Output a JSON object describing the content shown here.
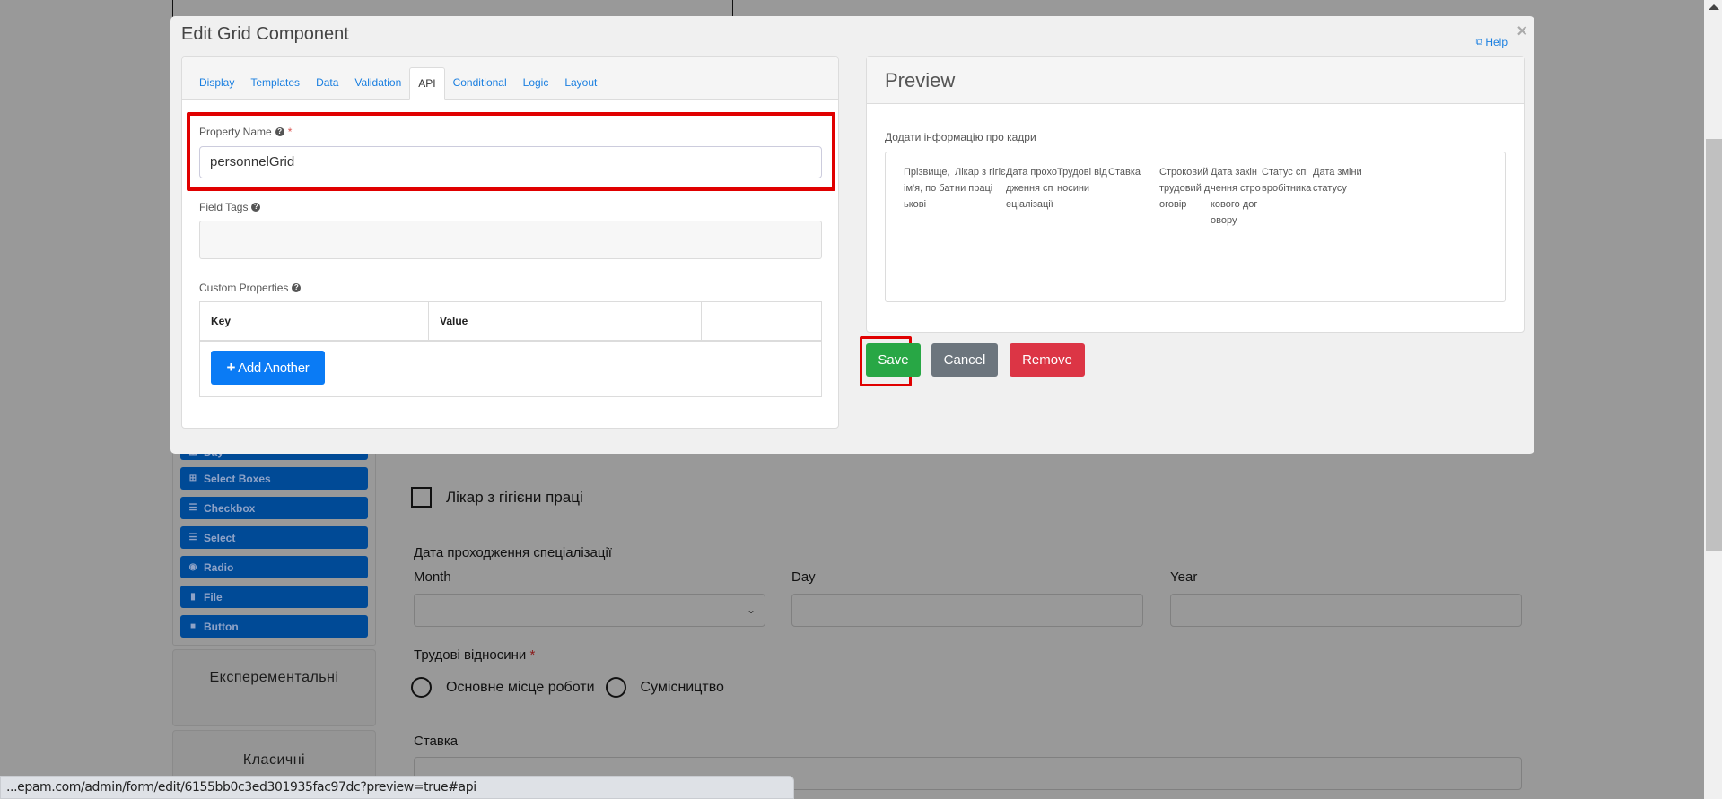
{
  "modal": {
    "title": "Edit Grid Component",
    "help_label": "Help",
    "close_label": "×",
    "tabs": [
      {
        "label": "Display"
      },
      {
        "label": "Templates"
      },
      {
        "label": "Data"
      },
      {
        "label": "Validation"
      },
      {
        "label": "API"
      },
      {
        "label": "Conditional"
      },
      {
        "label": "Logic"
      },
      {
        "label": "Layout"
      }
    ],
    "active_tab": "API",
    "property_name": {
      "label": "Property Name",
      "required_mark": "*",
      "value": "personnelGrid"
    },
    "field_tags": {
      "label": "Field Tags",
      "value": ""
    },
    "custom_properties": {
      "label": "Custom Properties",
      "columns": [
        "Key",
        "Value",
        ""
      ],
      "add_label": "Add Another",
      "add_icon": "+"
    },
    "preview": {
      "title": "Preview",
      "grid_label": "Додати інформацію про кадри",
      "columns": [
        "Прізвище, ім'я, по батькові",
        "Лікар з гігієни праці",
        "Дата проходження спеціалізації",
        "Трудові відносини",
        "Ставка",
        "Строковий трудовий договір",
        "Дата закінчення строкового договору",
        "Статус співробітника",
        "Дата зміни статусу"
      ]
    },
    "buttons": {
      "save": "Save",
      "cancel": "Cancel",
      "remove": "Remove"
    },
    "highlight_color": "#e00000"
  },
  "sidebar": {
    "items": [
      {
        "label": "Day",
        "icon": "calendar-icon"
      },
      {
        "label": "Select Boxes",
        "icon": "plus-square-icon"
      },
      {
        "label": "Checkbox",
        "icon": "list-icon"
      },
      {
        "label": "Select",
        "icon": "list-icon"
      },
      {
        "label": "Radio",
        "icon": "dot-circle-icon"
      },
      {
        "label": "File",
        "icon": "file-icon"
      },
      {
        "label": "Button",
        "icon": "square-icon"
      }
    ],
    "sections": [
      {
        "label": "Експерементальні"
      },
      {
        "label": "Класичні"
      }
    ]
  },
  "form": {
    "checkbox_label": "Лікар з гігієни праці",
    "date_label": "Дата проходження спеціалізації",
    "month_label": "Month",
    "day_label": "Day",
    "year_label": "Year",
    "relations_label": "Трудові відносини",
    "relations_required": "*",
    "radio_options": [
      "Основне місце роботи",
      "Сумісництво"
    ],
    "rate_label": "Ставка"
  },
  "statusbar": {
    "url": "...epam.com/admin/form/edit/6155bb0c3ed301935fac97dc?preview=true#api"
  }
}
